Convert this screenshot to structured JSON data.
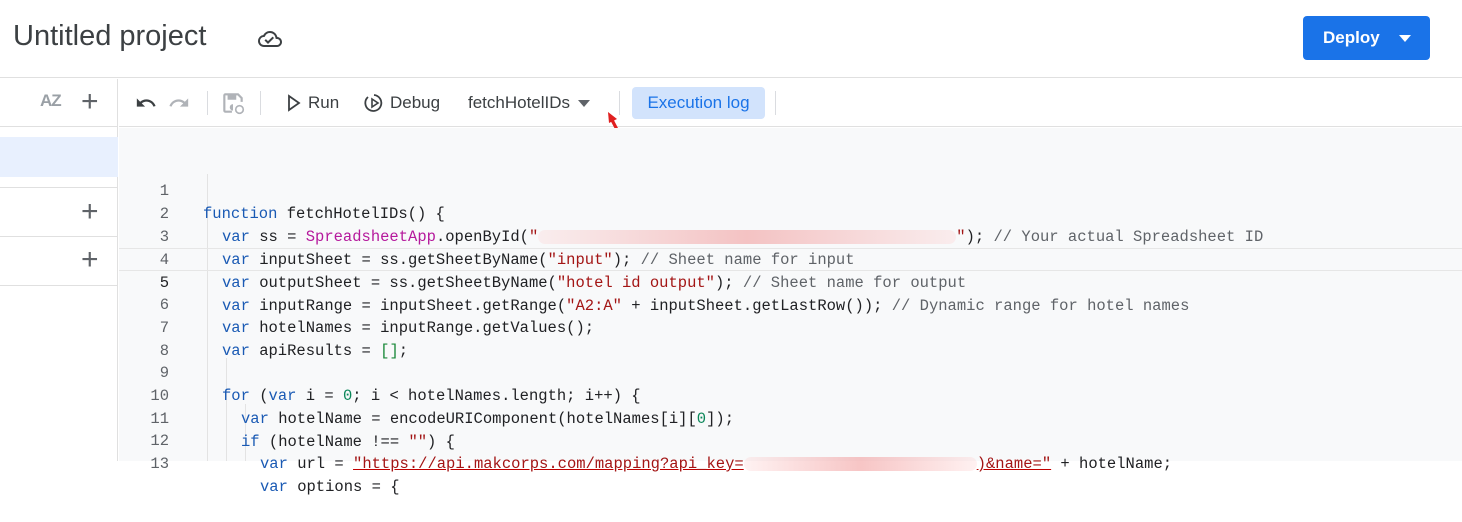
{
  "header": {
    "title": "Untitled project",
    "deploy_label": "Deploy"
  },
  "sidebar": {
    "sort_icon_text": "AZ"
  },
  "toolbar": {
    "run_label": "Run",
    "debug_label": "Debug",
    "function_select": "fetchHotelIDs",
    "execution_log_label": "Execution log"
  },
  "editor": {
    "current_line": 5,
    "lines": [
      {
        "n": "1"
      },
      {
        "n": "2"
      },
      {
        "n": "3"
      },
      {
        "n": "4"
      },
      {
        "n": "5"
      },
      {
        "n": "6"
      },
      {
        "n": "7"
      },
      {
        "n": "8"
      },
      {
        "n": "9"
      },
      {
        "n": "10"
      },
      {
        "n": "11"
      },
      {
        "n": "12"
      },
      {
        "n": "13"
      }
    ],
    "code": {
      "l1_kw": "function",
      "l1_rest": " fetchHotelIDs() {",
      "l2_kw": "var",
      "l2_a": " ss = ",
      "l2_cls": "SpreadsheetApp",
      "l2_b": ".openById(",
      "l2_q1": "\"",
      "l2_q2": "\"",
      "l2_c": "); ",
      "l2_cm": "// Your actual Spreadsheet ID",
      "l3_kw": "var",
      "l3_a": " inputSheet = ss.getSheetByName(",
      "l3_str": "\"input\"",
      "l3_b": "); ",
      "l3_cm": "// Sheet name for input",
      "l4_kw": "var",
      "l4_a": " outputSheet = ss.getSheetByName(",
      "l4_str": "\"hotel id output\"",
      "l4_b": "); ",
      "l4_cm": "// Sheet name for output",
      "l5_kw": "var",
      "l5_a": " inputRange = inputSheet.getRange(",
      "l5_str": "\"A2:A\"",
      "l5_b": " + inputSheet.getLastRow()); ",
      "l5_cm": "// Dynamic range for hotel names",
      "l6_kw": "var",
      "l6_a": " hotelNames = inputRange.getValues();",
      "l7_kw": "var",
      "l7_a": " apiResults = ",
      "l7_br": "[]",
      "l7_b": ";",
      "l9_kw": "for",
      "l9_a": " (",
      "l9_kw2": "var",
      "l9_b": " i = ",
      "l9_num": "0",
      "l9_c": "; i < hotelNames.length; i++) {",
      "l10_kw": "var",
      "l10_a": " hotelName = encodeURIComponent(hotelNames[i][",
      "l10_num": "0",
      "l10_b": "]);",
      "l11_kw": "if",
      "l11_a": " (hotelName !== ",
      "l11_str": "\"\"",
      "l11_b": ") {",
      "l12_kw": "var",
      "l12_a": " url = ",
      "l12_str1": "\"https://api.makcorps.com/mapping?api_key=",
      "l12_str2": ")&name=\"",
      "l12_b": " + hotelName;",
      "l13_kw": "var",
      "l13_a": " options = {"
    }
  }
}
